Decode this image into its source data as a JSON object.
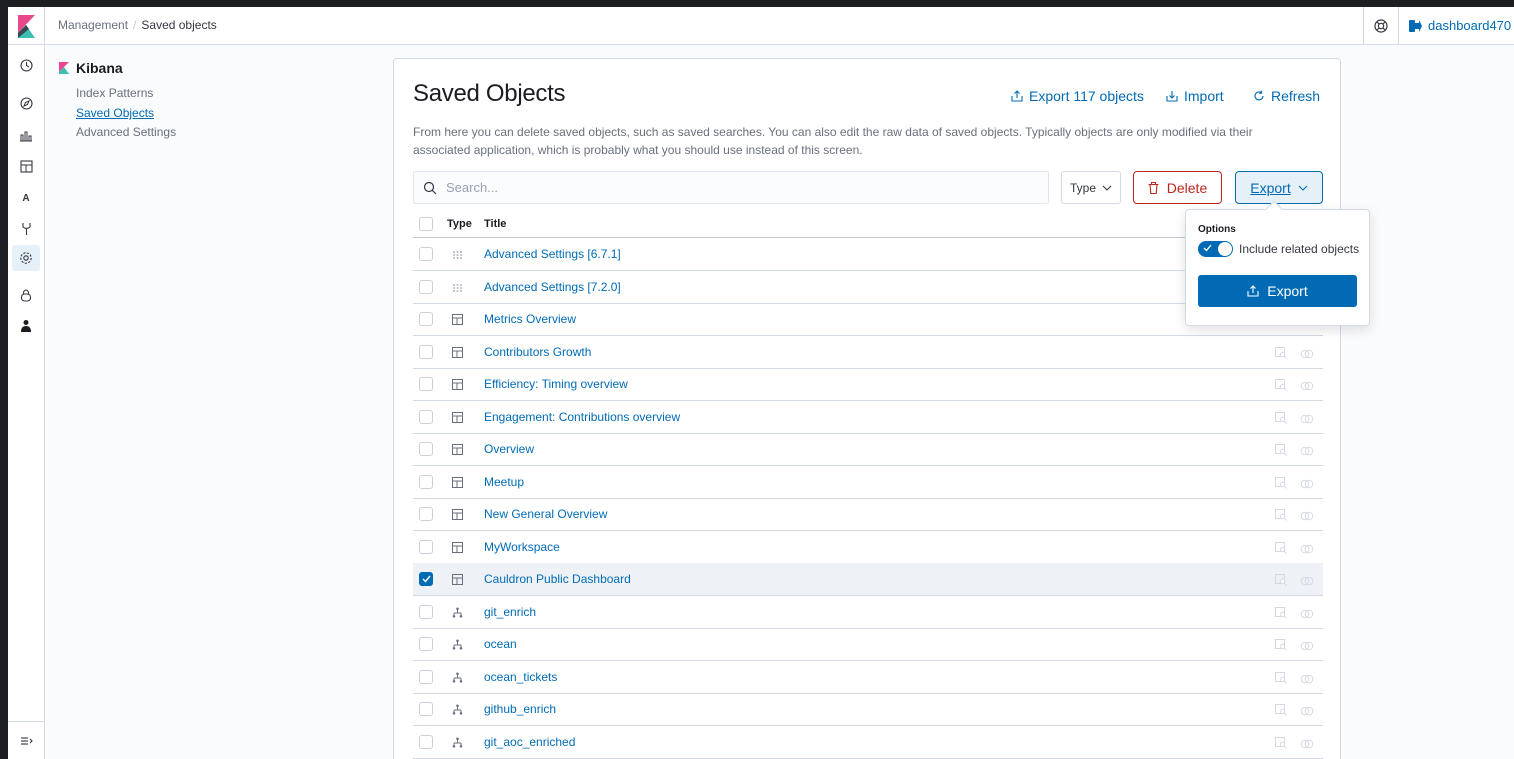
{
  "header": {
    "breadcrumbs": [
      "Management",
      "Saved objects"
    ],
    "user_label": "dashboard470"
  },
  "sidebar": {
    "title": "Kibana",
    "links": [
      "Index Patterns",
      "Saved Objects",
      "Advanced Settings"
    ],
    "selected": "Saved Objects",
    "nav_icons": [
      "clock-icon",
      "compass-icon",
      "visualize-icon",
      "dashboard-icon",
      "canvas-icon",
      "devtools-icon",
      "gear-icon",
      "lock-icon",
      "user-icon"
    ],
    "nav_letter": "A"
  },
  "main": {
    "title": "Saved Objects",
    "export_all": "Export 117 objects",
    "import": "Import",
    "refresh": "Refresh",
    "description": "From here you can delete saved objects, such as saved searches. You can also edit the raw data of saved objects. Typically objects are only modified via their associated application, which is probably what you should use instead of this screen.",
    "search_placeholder": "Search...",
    "type_filter": "Type",
    "delete": "Delete",
    "export": "Export"
  },
  "table": {
    "columns": [
      "Type",
      "Title"
    ],
    "rows": [
      {
        "type": "config",
        "title": "Advanced Settings [6.7.1]",
        "checked": false
      },
      {
        "type": "config",
        "title": "Advanced Settings [7.2.0]",
        "checked": false
      },
      {
        "type": "dashboard",
        "title": "Metrics Overview",
        "checked": false
      },
      {
        "type": "dashboard",
        "title": "Contributors Growth",
        "checked": false
      },
      {
        "type": "dashboard",
        "title": "Efficiency: Timing overview",
        "checked": false
      },
      {
        "type": "dashboard",
        "title": "Engagement: Contributions overview",
        "checked": false
      },
      {
        "type": "dashboard",
        "title": "Overview",
        "checked": false
      },
      {
        "type": "dashboard",
        "title": "Meetup",
        "checked": false
      },
      {
        "type": "dashboard",
        "title": "New General Overview",
        "checked": false
      },
      {
        "type": "dashboard",
        "title": "MyWorkspace",
        "checked": false
      },
      {
        "type": "dashboard",
        "title": "Cauldron Public Dashboard",
        "checked": true
      },
      {
        "type": "index-pattern",
        "title": "git_enrich",
        "checked": false
      },
      {
        "type": "index-pattern",
        "title": "ocean",
        "checked": false
      },
      {
        "type": "index-pattern",
        "title": "ocean_tickets",
        "checked": false
      },
      {
        "type": "index-pattern",
        "title": "github_enrich",
        "checked": false
      },
      {
        "type": "index-pattern",
        "title": "git_aoc_enriched",
        "checked": false
      }
    ]
  },
  "export_popover": {
    "options_label": "Options",
    "include_related": "Include related objects",
    "include_related_on": true,
    "button": "Export"
  },
  "colors": {
    "accent": "#006bb4",
    "danger": "#bd271e",
    "kibana_pink": "#e8488b",
    "kibana_teal": "#3ebeb0"
  }
}
